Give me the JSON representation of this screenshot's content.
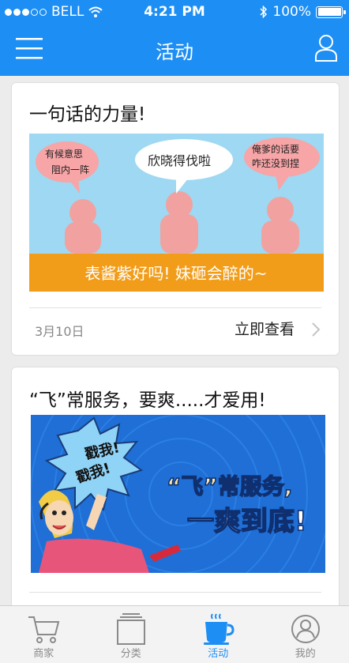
{
  "status": {
    "carrier": "BELL",
    "time": "4:21 PM",
    "battery": "100%"
  },
  "nav": {
    "title": "活动",
    "menu_icon": "menu-icon",
    "user_icon": "user-icon"
  },
  "cards": [
    {
      "title": "一句话的力量!",
      "banner_text": "表酱紫好吗! 妹砸会醉的~",
      "bubbles": [
        "有候意思 阻内一阵",
        "欣晓得伐啦",
        "俺爹的话要 咋还没到捏"
      ],
      "date": "3月10日",
      "action": "立即查看"
    },
    {
      "title": "“飞”常服务，要爽.....才爱用!",
      "burst_text": [
        "戳我!",
        "戳我!"
      ],
      "slogan_line1": "“飞”常服务,",
      "slogan_line2": "一爽到底!"
    }
  ],
  "tabs": [
    {
      "label": "商家",
      "icon": "cart-icon",
      "active": false
    },
    {
      "label": "分类",
      "icon": "category-icon",
      "active": false
    },
    {
      "label": "活动",
      "icon": "coffee-cup-icon",
      "active": true
    },
    {
      "label": "我的",
      "icon": "profile-icon",
      "active": false
    }
  ],
  "colors": {
    "brand": "#1d8ef4",
    "banner_orange": "#f29d1a",
    "sky": "#9ed8f2",
    "figure": "#f1a2a0"
  }
}
